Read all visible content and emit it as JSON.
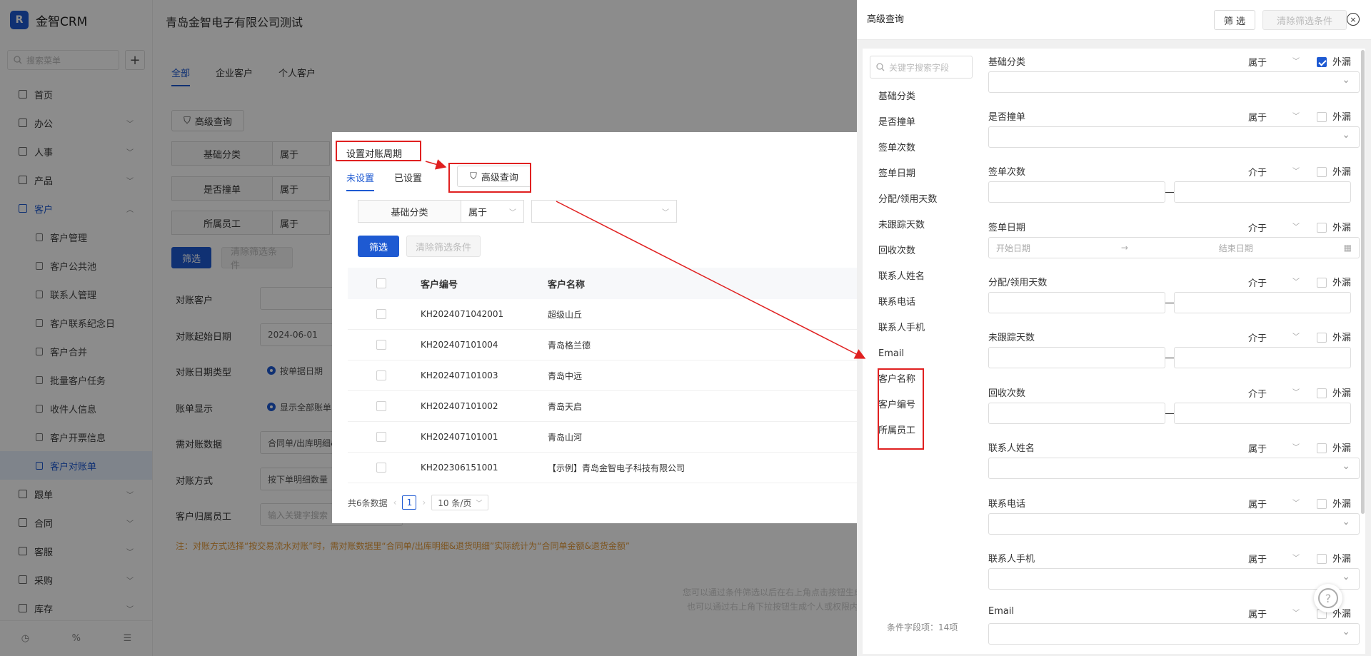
{
  "app": {
    "logo_mark": "R",
    "name": "金智CRM"
  },
  "sidebar": {
    "search_placeholder": "搜索菜单",
    "add": "+",
    "items": [
      {
        "label": "首页"
      },
      {
        "label": "办公"
      },
      {
        "label": "人事"
      },
      {
        "label": "产品"
      },
      {
        "label": "客户"
      }
    ],
    "sub_items": [
      {
        "label": "客户管理"
      },
      {
        "label": "客户公共池"
      },
      {
        "label": "联系人管理"
      },
      {
        "label": "客户联系纪念日"
      },
      {
        "label": "客户合并"
      },
      {
        "label": "批量客户任务"
      },
      {
        "label": "收件人信息"
      },
      {
        "label": "客户开票信息"
      },
      {
        "label": "客户对账单"
      }
    ],
    "items_after": [
      {
        "label": "跟单"
      },
      {
        "label": "合同"
      },
      {
        "label": "客服"
      },
      {
        "label": "采购"
      },
      {
        "label": "库存"
      }
    ]
  },
  "main": {
    "company": "青岛金智电子有限公司测试",
    "tabs": [
      "全部",
      "企业客户",
      "个人客户"
    ],
    "adv_query": "高级查询",
    "filters": [
      {
        "field": "基础分类",
        "op": "属于"
      },
      {
        "field": "是否撞单",
        "op": "属于"
      },
      {
        "field": "所属员工",
        "op": "属于"
      }
    ],
    "filter_btn": "筛选",
    "clear_btn": "清除筛选条件",
    "form": {
      "customer_label": "对账客户",
      "start_label": "对账起始日期",
      "start_value": "2024-06-01",
      "date_type_label": "对账日期类型",
      "date_type_value": "按单据日期",
      "display_label": "账单显示",
      "display_value": "显示全部账单",
      "data_label": "需对账数据",
      "data_value": "合同单/出库明细&",
      "method_label": "对账方式",
      "method_value": "按下单明细数量",
      "employee_label": "客户归属员工",
      "employee_placeholder": "输入关键字搜索"
    },
    "note": "注：对账方式选择“按交易流水对账”时，需对账数据里“合同单/出库明细&退货明细”实际统计为“合同单金额&退货金额”",
    "empty_line1": "您可以通过条件筛选以后在右上角点击按钮生成对账单",
    "empty_line2": "也可以通过右上角下拉按钮生成个人或权限内的账单"
  },
  "modal": {
    "title": "设置对账周期",
    "tabs": [
      "未设置",
      "已设置"
    ],
    "adv_query": "高级查询",
    "filter_field": "基础分类",
    "filter_op": "属于",
    "filter_btn": "筛选",
    "clear_btn": "清除筛选条件",
    "columns": [
      "客户编号",
      "客户名称"
    ],
    "rows": [
      {
        "code": "KH2024071042001",
        "name": "超级山丘"
      },
      {
        "code": "KH202407101004",
        "name": "青岛格兰德"
      },
      {
        "code": "KH202407101003",
        "name": "青岛中远"
      },
      {
        "code": "KH202407101002",
        "name": "青岛天启"
      },
      {
        "code": "KH202407101001",
        "name": "青岛山河"
      },
      {
        "code": "KH202306151001",
        "name": "【示例】青岛金智电子科技有限公司"
      }
    ],
    "total": "共6条数据",
    "page": "1",
    "page_size": "10 条/页"
  },
  "panel": {
    "title": "高级查询",
    "filter_btn": "筛 选",
    "clear_btn": "清除筛选条件",
    "close": "×",
    "search_placeholder": "关键字搜索字段",
    "field_list": [
      "基础分类",
      "是否撞单",
      "签单次数",
      "签单日期",
      "分配/领用天数",
      "未跟踪天数",
      "回收次数",
      "联系人姓名",
      "联系电话",
      "联系人手机",
      "Email",
      "客户名称",
      "客户编号",
      "所属员工"
    ],
    "count_text": "条件字段项：14项",
    "ext_label": "外漏",
    "fields": [
      {
        "label": "基础分类",
        "op": "属于",
        "type": "select",
        "checked": true
      },
      {
        "label": "是否撞单",
        "op": "属于",
        "type": "select",
        "checked": false
      },
      {
        "label": "签单次数",
        "op": "介于",
        "type": "range",
        "checked": false
      },
      {
        "label": "签单日期",
        "op": "介于",
        "type": "date",
        "checked": false,
        "start": "开始日期",
        "end": "结束日期"
      },
      {
        "label": "分配/领用天数",
        "op": "介于",
        "type": "range",
        "checked": false
      },
      {
        "label": "未跟踪天数",
        "op": "介于",
        "type": "range",
        "checked": false
      },
      {
        "label": "回收次数",
        "op": "介于",
        "type": "range",
        "checked": false
      },
      {
        "label": "联系人姓名",
        "op": "属于",
        "type": "select",
        "checked": false
      },
      {
        "label": "联系电话",
        "op": "属于",
        "type": "select",
        "checked": false
      },
      {
        "label": "联系人手机",
        "op": "属于",
        "type": "select",
        "checked": false
      },
      {
        "label": "Email",
        "op": "属于",
        "type": "select",
        "checked": false
      }
    ]
  },
  "colors": {
    "accent": "#1e5ad2",
    "annotation": "#e02020",
    "note": "#e39a3a"
  }
}
